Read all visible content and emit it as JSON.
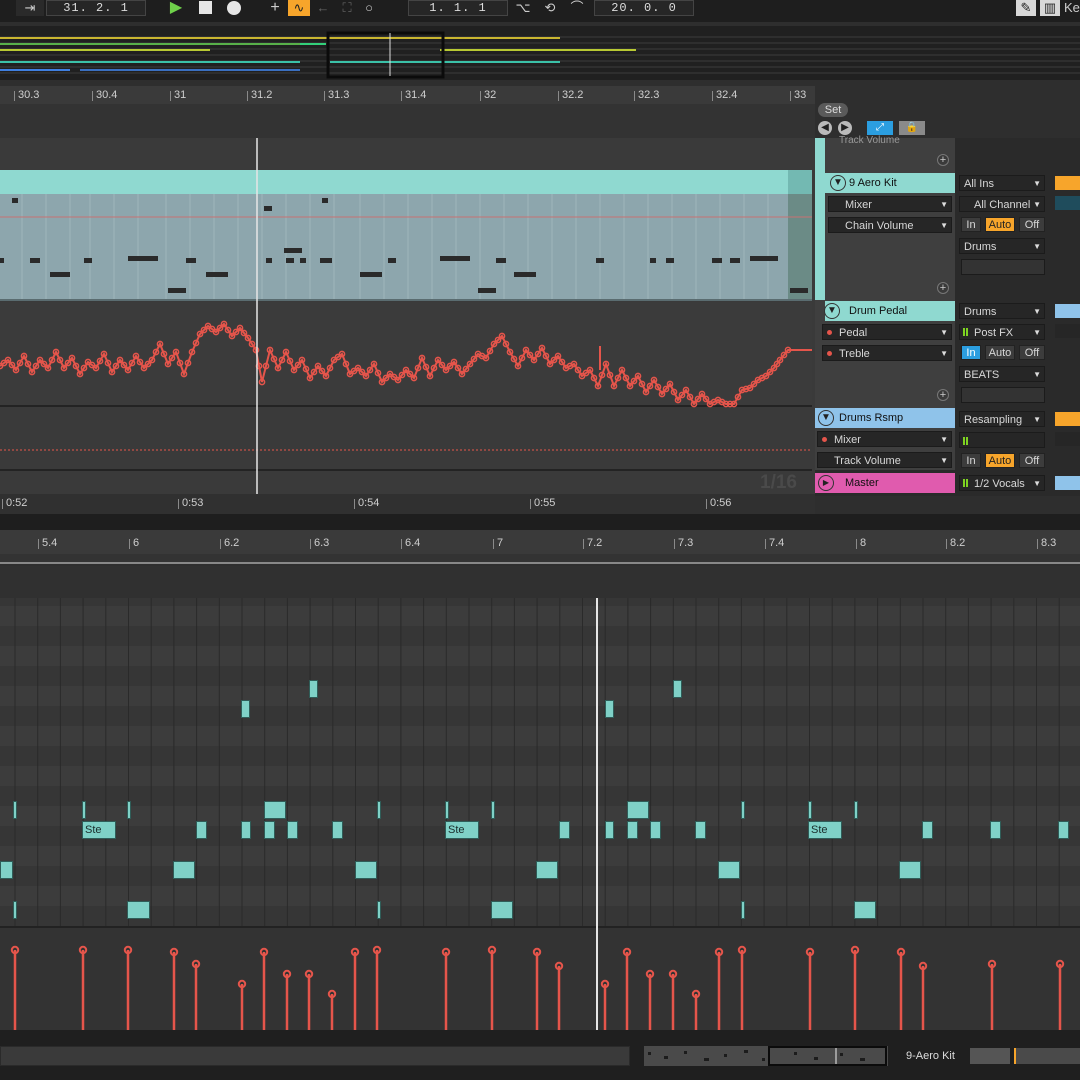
{
  "transport": {
    "position": "31. 2. 1",
    "loop_start": "1. 1. 1",
    "loop_length": "20. 0. 0",
    "keys_label": "Ke"
  },
  "arrangement": {
    "ruler": [
      "30.3",
      "30.4",
      "31",
      "31.2",
      "31.3",
      "31.4",
      "32",
      "32.2",
      "32.3",
      "32.4",
      "33"
    ],
    "time_ruler": [
      "0:52",
      "0:53",
      "0:54",
      "0:55",
      "0:56"
    ],
    "grid_label": "1/16",
    "set_label": "Set"
  },
  "mixer": {
    "partial_label": "Track Volume",
    "tracks": [
      {
        "name": "9 Aero Kit",
        "device": "Mixer",
        "param": "Chain Volume",
        "input": "All Ins",
        "channel": "All Channel",
        "monitor": [
          "In",
          "Auto",
          "Off"
        ],
        "output": "Drums",
        "color": "#8fd9d0"
      },
      {
        "name": "Drum Pedal",
        "device": "Pedal",
        "param": "Treble",
        "input": "Drums",
        "channel": "Post FX",
        "monitor": [
          "In",
          "Auto",
          "Off"
        ],
        "output": "BEATS",
        "color": "#8fd9d0"
      },
      {
        "name": "Drums Rsmp",
        "device": "Mixer",
        "param": "Track Volume",
        "input": "Resampling",
        "channel": "",
        "monitor": [
          "In",
          "Auto",
          "Off"
        ],
        "color": "#8fc3ea"
      },
      {
        "name": "Master",
        "output": "1/2 Vocals",
        "color": "#e05bae"
      }
    ]
  },
  "clip_editor": {
    "ruler": [
      "5.4",
      "6",
      "6.2",
      "6.3",
      "6.4",
      "7",
      "7.2",
      "7.3",
      "7.4",
      "8",
      "8.2",
      "8.3"
    ],
    "note_label": "Ste"
  },
  "status_bar": {
    "track_name": "9-Aero Kit"
  },
  "colors": {
    "clip": "#8fd9d0",
    "automation": "#e5554b",
    "accent": "#f7a52b",
    "master": "#e05bae"
  }
}
